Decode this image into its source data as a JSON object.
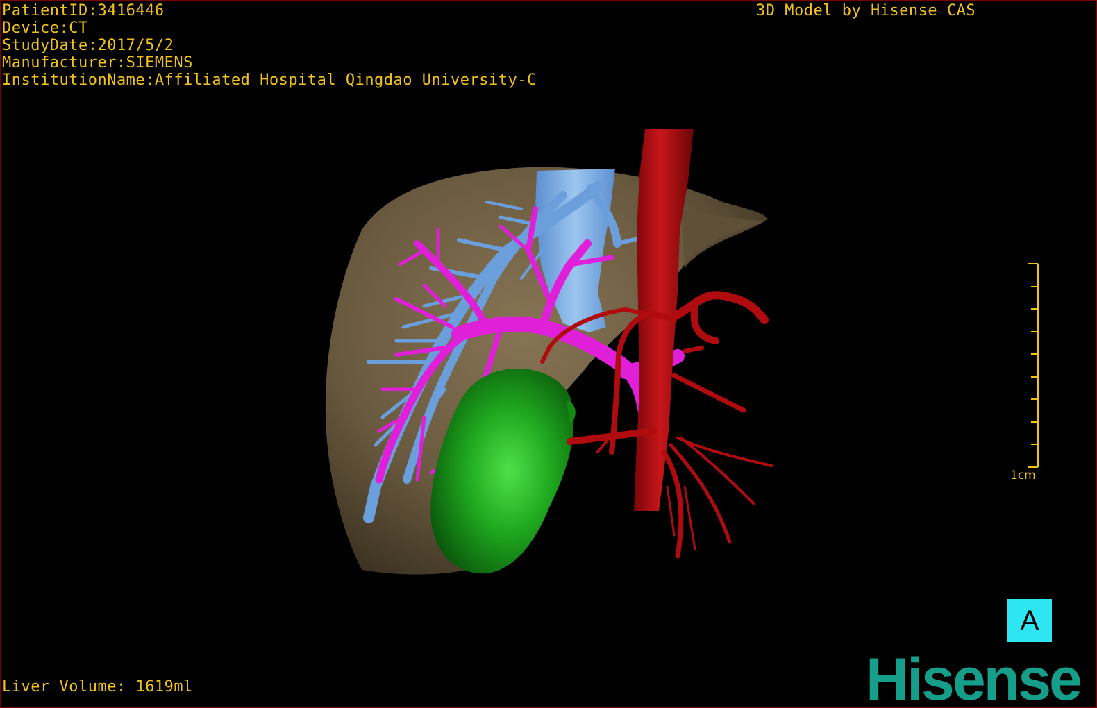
{
  "header": {
    "patient_id": "PatientID:3416446",
    "device": "Device:CT",
    "study_date": "StudyDate:2017/5/2",
    "manufacturer": "Manufacturer:SIEMENS",
    "institution": "InstitutionName:Affiliated Hospital Qingdao University-C"
  },
  "credit": "3D Model by Hisense CAS",
  "footer": {
    "liver_volume": "Liver Volume: 1619ml"
  },
  "scale_bar": {
    "label": "1cm"
  },
  "orientation": {
    "label": "A"
  },
  "brand": {
    "logo_text": "Hisense"
  },
  "colors": {
    "overlay_text": "#f2c21b",
    "liver": "#7d6a4c",
    "hepatic_vein": "#6b9fdc",
    "portal_vein": "#e020d8",
    "artery": "#b00c10",
    "tumor": "#1fa81f",
    "orientation_box": "#2ee6f2",
    "brand": "#159e8a"
  }
}
